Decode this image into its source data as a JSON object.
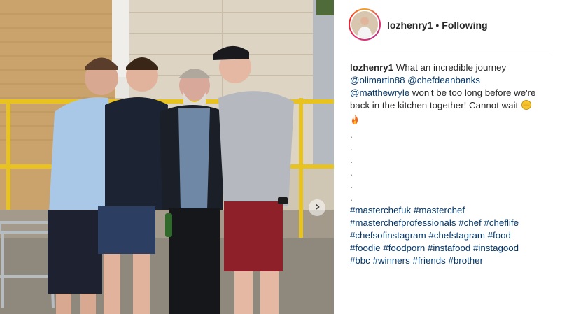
{
  "post": {
    "username": "lozhenry1",
    "separator": "•",
    "follow_status": "Following"
  },
  "caption": {
    "username": "lozhenry1",
    "text_1": " What an incredible journey",
    "mention_1": "@olimartin88",
    "mention_2": "@chefdeanbanks",
    "mention_3": "@matthewryle",
    "text_2": " won't be too long before we're",
    "text_3": "back in the kitchen together! Cannot wait",
    "emoji_1": "fist-bump-emoji",
    "emoji_2": "fire-emoji",
    "dots": [
      ".",
      ".",
      ".",
      ".",
      ".",
      "."
    ],
    "hashtags": [
      [
        "#masterchefuk",
        "#masterchef"
      ],
      [
        "#masterchefprofessionals",
        "#chef",
        "#cheflife"
      ],
      [
        "#chefsofinstagram",
        "#chefstagram",
        "#food"
      ],
      [
        "#foodie",
        "#foodporn",
        "#instafood",
        "#instagood"
      ],
      [
        "#bbc",
        "#winners",
        "#friends",
        "#brother"
      ]
    ]
  },
  "carousel": {
    "next_icon": "chevron-right-icon"
  },
  "colors": {
    "link": "#003569",
    "text": "#262626",
    "divider": "#efefef"
  }
}
